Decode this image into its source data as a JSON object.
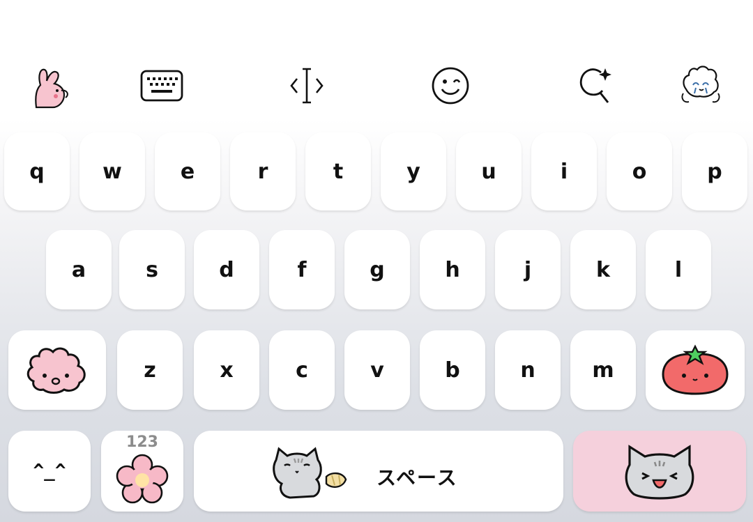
{
  "toolbar": {
    "items": [
      {
        "name": "pink-bunny-sticker-icon"
      },
      {
        "name": "keyboard-icon"
      },
      {
        "name": "cursor-move-icon"
      },
      {
        "name": "emoji-smile-icon"
      },
      {
        "name": "ai-search-icon"
      },
      {
        "name": "bunny-face-sticker-icon"
      }
    ]
  },
  "keyboard": {
    "row1": [
      "q",
      "w",
      "e",
      "r",
      "t",
      "y",
      "u",
      "i",
      "o",
      "p"
    ],
    "row2": [
      "a",
      "s",
      "d",
      "f",
      "g",
      "h",
      "j",
      "k",
      "l"
    ],
    "row3": [
      "z",
      "x",
      "c",
      "v",
      "b",
      "n",
      "m"
    ],
    "shift_icon": "pink-bunny-shift-icon",
    "delete_icon": "tomato-delete-icon",
    "emoticon_label": "^_^",
    "num_label": "123",
    "num_icon": "pink-flower-icon",
    "space_label": "スペース",
    "space_icon": "gray-cat-sticker-icon",
    "enter_icon": "cat-face-enter-icon"
  },
  "colors": {
    "key_bg": "#ffffff",
    "enter_bg": "#f5d0dc",
    "bunny_pink": "#f7c4cf",
    "tomato_red": "#f26a6a",
    "leaf_green": "#4fcf60",
    "flower_pink": "#f7b9c7",
    "flower_center": "#ffe3a6",
    "cat_gray": "#d8dadd"
  }
}
